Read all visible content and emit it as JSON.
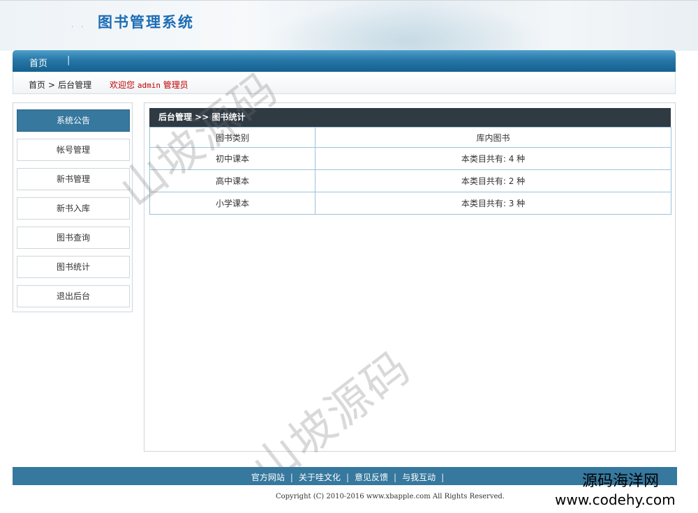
{
  "header": {
    "logo_dots": ". .",
    "title": "图书管理系统"
  },
  "nav": {
    "home": "首页",
    "separator": "|"
  },
  "breadcrumb": {
    "home": "首页",
    "arrow": ">",
    "current": "后台管理",
    "welcome_prefix": "欢迎您",
    "username": "admin",
    "role": "管理员"
  },
  "sidebar": {
    "items": [
      {
        "label": "系统公告",
        "active": true
      },
      {
        "label": "帐号管理"
      },
      {
        "label": "新书管理"
      },
      {
        "label": "新书入库"
      },
      {
        "label": "图书查询"
      },
      {
        "label": "图书统计"
      },
      {
        "label": "退出后台"
      }
    ]
  },
  "panel": {
    "title": "后台管理 >> 图书统计",
    "headers": [
      "图书类别",
      "库内图书"
    ],
    "rows": [
      {
        "category": "初中课本",
        "count": "本类目共有: 4  种"
      },
      {
        "category": "高中课本",
        "count": "本类目共有: 2  种"
      },
      {
        "category": "小学课本",
        "count": "本类目共有: 3  种"
      }
    ]
  },
  "watermark": "山坡源码",
  "footer": {
    "links": [
      "官方网站",
      "关于哇文化",
      "意见反馈",
      "与我互动"
    ],
    "separator": "|",
    "copyright": "Copyright (C) 2010-2016 www.xbapple.com All Rights Reserved."
  },
  "corner": {
    "brand": "源码海洋网",
    "url": "www.codehy.com"
  },
  "colors": {
    "nav_blue": "#2777a8",
    "sidebar_active": "#36789e",
    "panel_head": "#2f3a43",
    "welcome_red": "#c00000",
    "title_blue": "#1d6db5"
  }
}
